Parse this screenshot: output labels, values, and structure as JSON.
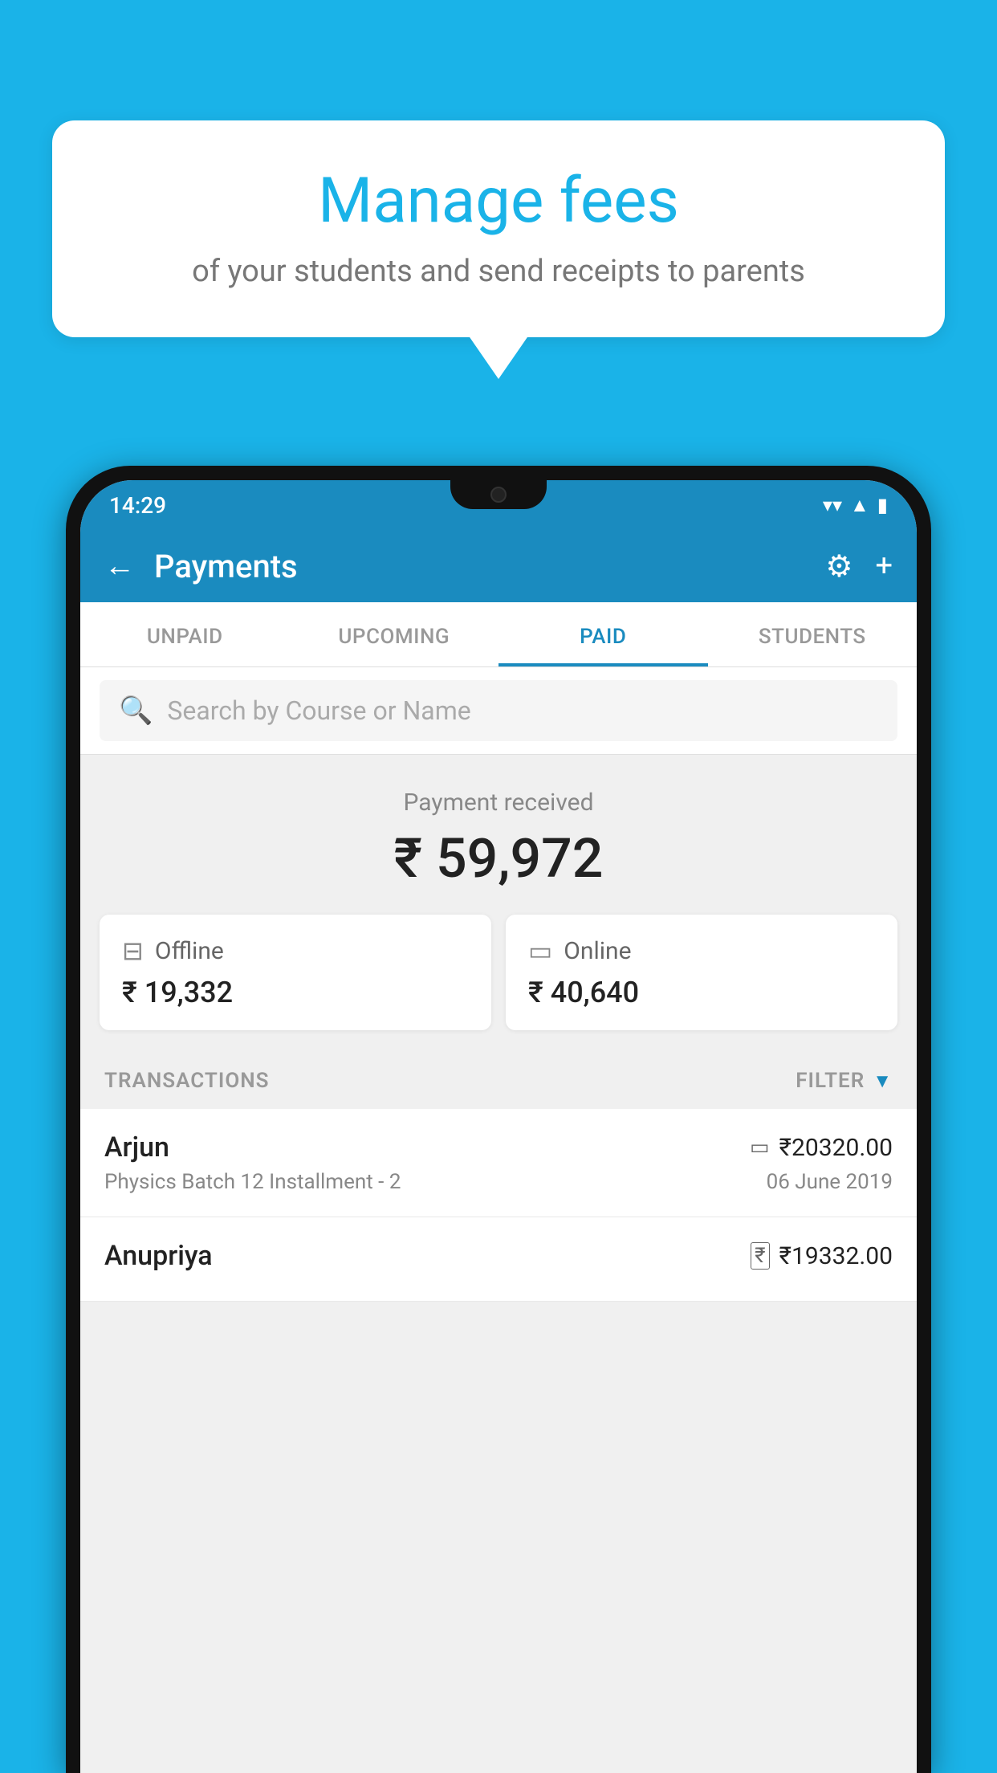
{
  "background_color": "#1ab3e8",
  "speech_bubble": {
    "title": "Manage fees",
    "subtitle": "of your students and send receipts to parents"
  },
  "status_bar": {
    "time": "14:29",
    "wifi_icon": "wifi",
    "signal_icon": "signal",
    "battery_icon": "battery"
  },
  "app_bar": {
    "back_icon": "←",
    "title": "Payments",
    "settings_icon": "⚙",
    "add_icon": "+"
  },
  "tabs": [
    {
      "label": "UNPAID",
      "active": false
    },
    {
      "label": "UPCOMING",
      "active": false
    },
    {
      "label": "PAID",
      "active": true
    },
    {
      "label": "STUDENTS",
      "active": false
    }
  ],
  "search": {
    "placeholder": "Search by Course or Name"
  },
  "payment_summary": {
    "label": "Payment received",
    "amount": "₹ 59,972",
    "offline": {
      "label": "Offline",
      "amount": "₹ 19,332"
    },
    "online": {
      "label": "Online",
      "amount": "₹ 40,640"
    }
  },
  "transactions_section": {
    "label": "TRANSACTIONS",
    "filter_label": "FILTER"
  },
  "transactions": [
    {
      "name": "Arjun",
      "course": "Physics Batch 12 Installment - 2",
      "amount": "₹20320.00",
      "date": "06 June 2019",
      "payment_type": "card"
    },
    {
      "name": "Anupriya",
      "course": "",
      "amount": "₹19332.00",
      "date": "",
      "payment_type": "cash"
    }
  ]
}
